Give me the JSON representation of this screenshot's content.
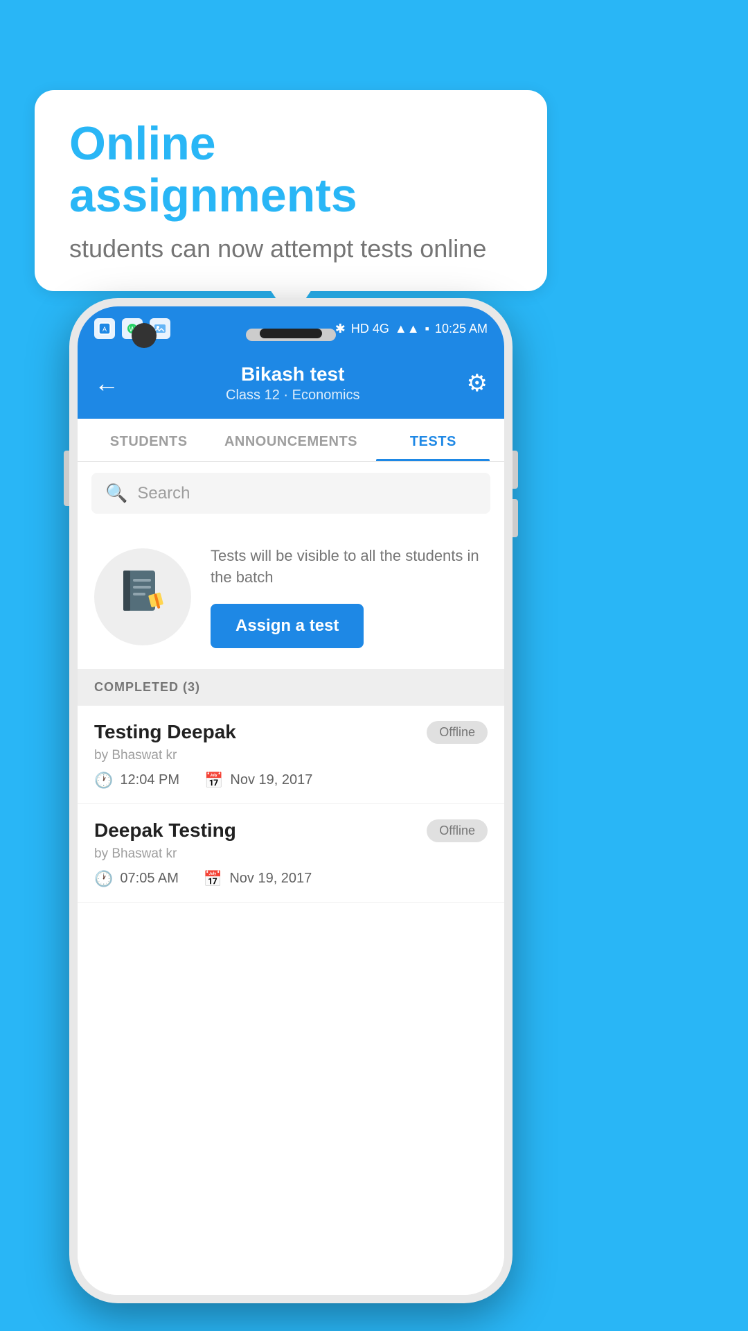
{
  "background": {
    "color": "#29b6f6"
  },
  "speech_bubble": {
    "title": "Online assignments",
    "subtitle": "students can now attempt tests online"
  },
  "status_bar": {
    "time": "10:25 AM",
    "network": "HD 4G",
    "icons": [
      "app1",
      "whatsapp",
      "image"
    ]
  },
  "header": {
    "title": "Bikash test",
    "subtitle": "Class 12 · Economics",
    "back_label": "←",
    "gear_label": "⚙"
  },
  "tabs": [
    {
      "label": "STUDENTS",
      "active": false
    },
    {
      "label": "ANNOUNCEMENTS",
      "active": false
    },
    {
      "label": "TESTS",
      "active": true
    }
  ],
  "search": {
    "placeholder": "Search",
    "icon": "🔍"
  },
  "assign_section": {
    "description": "Tests will be visible to all the students in the batch",
    "button_label": "Assign a test",
    "icon": "📓"
  },
  "completed_section": {
    "header": "COMPLETED (3)",
    "items": [
      {
        "name": "Testing Deepak",
        "by": "by Bhaswat kr",
        "time": "12:04 PM",
        "date": "Nov 19, 2017",
        "badge": "Offline"
      },
      {
        "name": "Deepak Testing",
        "by": "by Bhaswat kr",
        "time": "07:05 AM",
        "date": "Nov 19, 2017",
        "badge": "Offline"
      }
    ]
  }
}
